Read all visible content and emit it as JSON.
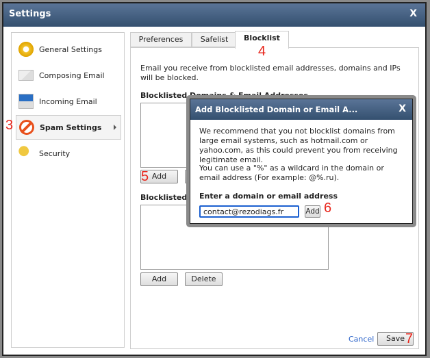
{
  "window": {
    "title": "Settings",
    "close": "X"
  },
  "sidebar": {
    "items": [
      {
        "label": "General Settings",
        "icon": "gear-icon"
      },
      {
        "label": "Composing Email",
        "icon": "pencil-envelope-icon"
      },
      {
        "label": "Incoming Email",
        "icon": "incoming-envelope-icon"
      },
      {
        "label": "Spam Settings",
        "icon": "no-entry-icon",
        "selected": true
      },
      {
        "label": "Security",
        "icon": "key-icon"
      }
    ]
  },
  "tabs": [
    {
      "label": "Preferences"
    },
    {
      "label": "Safelist"
    },
    {
      "label": "Blocklist",
      "active": true
    }
  ],
  "blocklist": {
    "intro": "Email you receive from blocklisted email addresses, domains and IPs will be blocked.",
    "domains_heading": "Blocklisted Domains & Email Addresses",
    "ips_heading": "Blocklisted IPs",
    "add": "Add",
    "delete": "Delete"
  },
  "dialog": {
    "title": "Add Blocklisted Domain or Email A...",
    "close": "X",
    "para1": "We recommend that you not blocklist domains from large email systems, such as hotmail.com or yahoo.com, as this could prevent you from receiving legitimate email.",
    "para2": "You can use a \"%\" as a wildcard in the domain or email address (For example: @%.ru).",
    "field_label": "Enter a domain or email address",
    "field_value": "contact@rezodiags.fr",
    "add": "Add"
  },
  "footer": {
    "cancel": "Cancel",
    "save": "Save"
  },
  "annotations": {
    "a3": "3",
    "a4": "4",
    "a5": "5",
    "a6": "6",
    "a7": "7"
  }
}
